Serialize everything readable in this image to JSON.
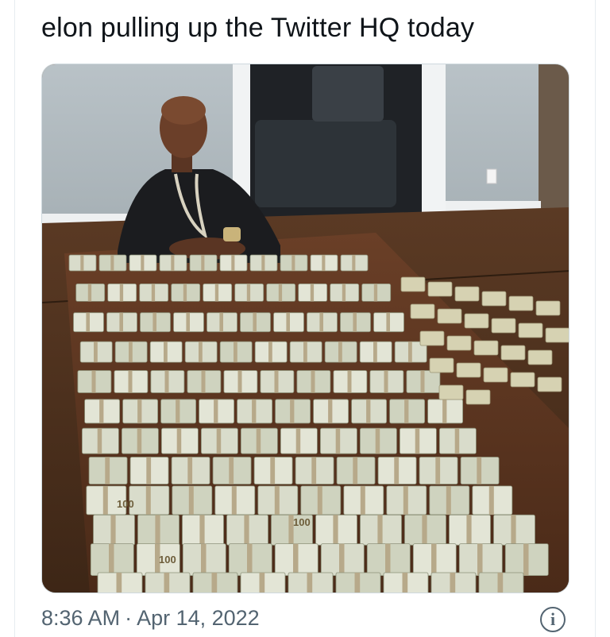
{
  "tweet": {
    "text": "elon pulling up the Twitter HQ today",
    "time": "8:36 AM",
    "separator": "·",
    "date": "Apr 14, 2022"
  },
  "media": {
    "banknote_denomination": "100"
  },
  "icons": {
    "info": "info-icon",
    "info_glyph": "i"
  },
  "colors": {
    "text": "#0f1419",
    "secondary": "#536471",
    "border": "#cfd9de"
  }
}
